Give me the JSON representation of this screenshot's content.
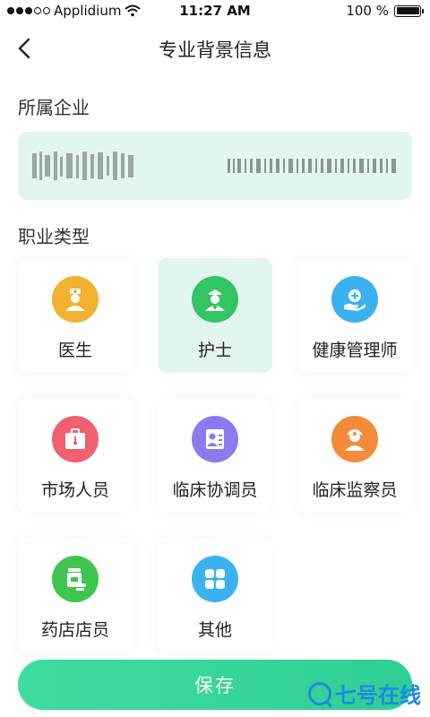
{
  "status_bar": {
    "carrier": "Applidium",
    "time": "11:27 AM",
    "battery": "100 %",
    "battery_level": 1.0
  },
  "nav": {
    "title": "专业背景信息",
    "back_icon": "chevron-left-icon"
  },
  "company": {
    "label": "所属企业"
  },
  "profession": {
    "label": "职业类型",
    "selected": "护士",
    "items": [
      {
        "label": "医生",
        "icon": "doctor-icon",
        "color": "#f2b12f"
      },
      {
        "label": "护士",
        "icon": "nurse-icon",
        "color": "#33c463"
      },
      {
        "label": "健康管理师",
        "icon": "health-care-icon",
        "color": "#3ab2f0"
      },
      {
        "label": "市场人员",
        "icon": "briefcase-icon",
        "color": "#f1606e"
      },
      {
        "label": "临床协调员",
        "icon": "coordinator-icon",
        "color": "#8a7cf0"
      },
      {
        "label": "临床监察员",
        "icon": "monitor-icon",
        "color": "#f58a3a"
      },
      {
        "label": "药店店员",
        "icon": "pharmacy-icon",
        "color": "#3ec44f"
      },
      {
        "label": "其他",
        "icon": "grid-icon",
        "color": "#3ab2f0"
      }
    ]
  },
  "save_button": {
    "label": "保存"
  },
  "watermark": {
    "text": "七号在线"
  }
}
